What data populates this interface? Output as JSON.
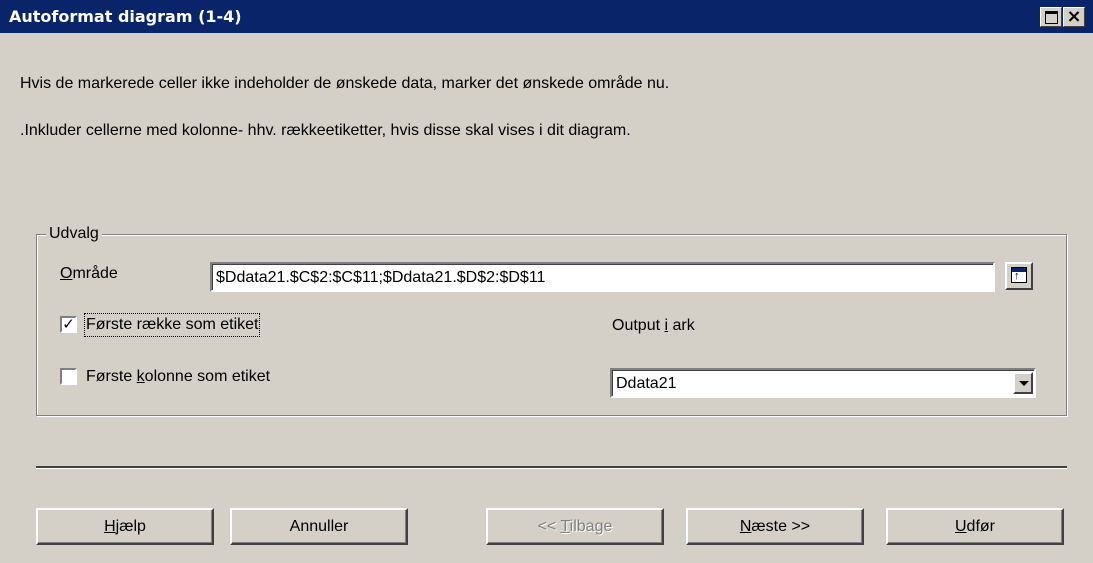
{
  "window": {
    "title": "Autoformat diagram (1-4)"
  },
  "instructions": {
    "line1": "Hvis de markerede celler ikke indeholder de ønskede data, marker det ønskede område nu.",
    "line2": ".Inkluder cellerne med kolonne- hhv. rækkeetiketter, hvis disse skal vises i dit diagram."
  },
  "selection": {
    "group_label": "Udvalg",
    "range_label_accel": "O",
    "range_label_rest": "mråde",
    "range_value": "$Ddata21.$C$2:$C$11;$Ddata21.$D$2:$D$11",
    "first_row_label": "Første række som etiket",
    "first_row_checked": true,
    "first_col_label_pre": "Første ",
    "first_col_label_accel": "k",
    "first_col_label_post": "olonne som etiket",
    "first_col_checked": false,
    "output_label_pre": "Output ",
    "output_label_accel": "i",
    "output_label_post": " ark",
    "output_sheet": "Ddata21"
  },
  "buttons": {
    "help_accel": "H",
    "help_rest": "jælp",
    "cancel": "Annuller",
    "back_pre": "<< ",
    "back_accel": "T",
    "back_rest": "ilbage",
    "back_enabled": false,
    "next_accel": "N",
    "next_rest": "æste >>",
    "finish_accel": "U",
    "finish_rest": "dfør"
  },
  "colors": {
    "titlebar": "#0a246a",
    "dialog_bg": "#d4d0c8"
  }
}
